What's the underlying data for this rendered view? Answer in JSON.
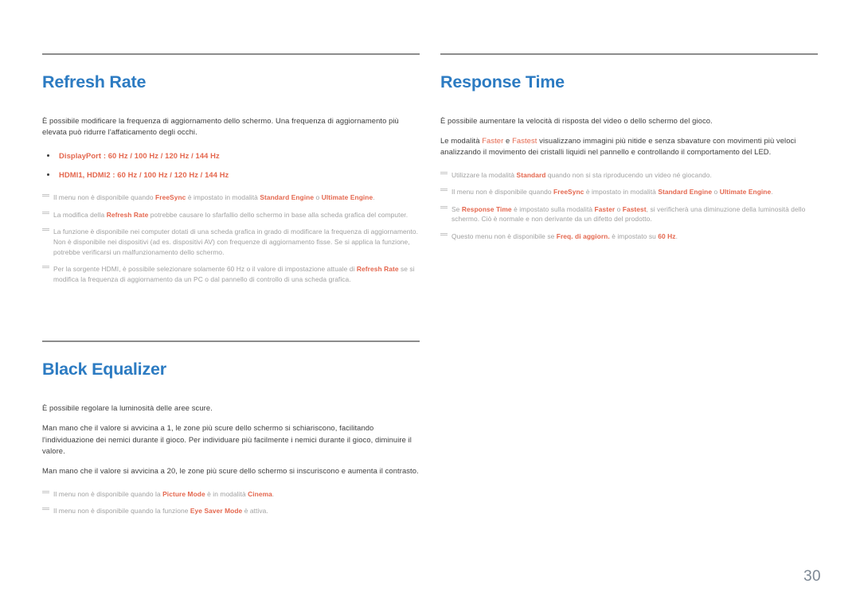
{
  "document": {
    "language": "it",
    "page_number": "30",
    "colors": {
      "heading_blue": "#2c7bc2",
      "accent_orange": "#e4674e",
      "body_gray": "#3d3d3d",
      "note_gray": "#a0a0a0",
      "rule_gray": "#8c8c8c",
      "page_number_gray": "#7d8894"
    }
  },
  "left_column": {
    "sections": [
      {
        "id": "refresh-rate",
        "title": "Refresh Rate",
        "paragraphs": [
          "È possibile modificare la frequenza di aggiornamento dello schermo. Una frequenza di aggiornamento più elevata può ridurre l'affaticamento degli occhi."
        ],
        "bullets": [
          "DisplayPort : 60 Hz / 100 Hz / 120 Hz / 144 Hz",
          "HDMI1, HDMI2 : 60 Hz / 100 Hz / 120 Hz / 144 Hz"
        ],
        "notes": [
          {
            "id": "note-freesync",
            "segments": [
              {
                "text": "Il menu non è disponibile quando ",
                "style": "plain"
              },
              {
                "text": "FreeSync",
                "style": "highlight"
              },
              {
                "text": " è impostato in modalità ",
                "style": "plain"
              },
              {
                "text": "Standard Engine",
                "style": "highlight"
              },
              {
                "text": " o ",
                "style": "plain"
              },
              {
                "text": "Ultimate Engine",
                "style": "highlight"
              },
              {
                "text": ".",
                "style": "plain"
              }
            ]
          },
          {
            "id": "note-flicker",
            "segments": [
              {
                "text": "La modifica della ",
                "style": "plain"
              },
              {
                "text": "Refresh Rate",
                "style": "highlight"
              },
              {
                "text": " potrebbe causare lo sfarfallio dello schermo in base alla scheda grafica del computer.",
                "style": "plain"
              }
            ]
          },
          {
            "id": "note-graphics-card",
            "segments": [
              {
                "text": "La funzione è disponibile nei computer dotati di una scheda grafica in grado di modificare la frequenza di aggiornamento.",
                "style": "plain"
              }
            ],
            "sub": "Non è disponibile nei dispositivi (ad es. dispositivi AV) con frequenze di aggiornamento fisse. Se si applica la funzione, potrebbe verificarsi un malfunzionamento dello schermo."
          },
          {
            "id": "note-hdmi-source",
            "segments": [
              {
                "text": "Per la sorgente HDMI, è possibile selezionare solamente 60 Hz o il valore di impostazione attuale di ",
                "style": "plain"
              },
              {
                "text": "Refresh Rate",
                "style": "highlight"
              },
              {
                "text": " se si modifica la frequenza di aggiornamento da un PC o dal pannello di controllo di una scheda grafica.",
                "style": "plain"
              }
            ]
          }
        ]
      },
      {
        "id": "black-equalizer",
        "title": "Black Equalizer",
        "paragraphs": [
          "È possibile regolare la luminosità delle aree scure.",
          "Man mano che il valore si avvicina a 1, le zone più scure dello schermo si schiariscono, facilitando l'individuazione dei nemici durante il gioco. Per individuare più facilmente i nemici durante il gioco, diminuire il valore.",
          "Man mano che il valore si avvicina a 20, le zone più scure dello schermo si inscuriscono e aumenta il contrasto."
        ],
        "bullets": [],
        "notes": [
          {
            "id": "note-picture-mode",
            "segments": [
              {
                "text": "Il menu non è disponibile quando la ",
                "style": "plain"
              },
              {
                "text": "Picture Mode",
                "style": "highlight"
              },
              {
                "text": " è in modalità ",
                "style": "plain"
              },
              {
                "text": "Cinema",
                "style": "highlight"
              },
              {
                "text": ".",
                "style": "plain"
              }
            ]
          },
          {
            "id": "note-eye-saver",
            "segments": [
              {
                "text": "Il menu non è disponibile quando la funzione ",
                "style": "plain"
              },
              {
                "text": "Eye Saver Mode",
                "style": "highlight"
              },
              {
                "text": " è attiva.",
                "style": "plain"
              }
            ]
          }
        ]
      }
    ]
  },
  "right_column": {
    "sections": [
      {
        "id": "response-time",
        "title": "Response Time",
        "rich_paragraphs": [
          [
            {
              "text": "È possibile aumentare la velocità di risposta del video o dello schermo del gioco.",
              "style": "plain"
            }
          ],
          [
            {
              "text": "Le modalità ",
              "style": "plain"
            },
            {
              "text": "Faster",
              "style": "orange"
            },
            {
              "text": " e ",
              "style": "plain"
            },
            {
              "text": "Fastest",
              "style": "orange"
            },
            {
              "text": " visualizzano immagini più nitide e senza sbavature con movimenti più veloci analizzando il movimento dei cristalli liquidi nel pannello e controllando il comportamento del LED.",
              "style": "plain"
            }
          ]
        ],
        "notes": [
          {
            "id": "note-standard-mode",
            "segments": [
              {
                "text": "Utilizzare la modalità ",
                "style": "plain"
              },
              {
                "text": "Standard",
                "style": "highlight"
              },
              {
                "text": " quando non si sta riproducendo un video né giocando.",
                "style": "plain"
              }
            ]
          },
          {
            "id": "note-freesync-rt",
            "segments": [
              {
                "text": "Il menu non è disponibile quando ",
                "style": "plain"
              },
              {
                "text": "FreeSync",
                "style": "highlight"
              },
              {
                "text": " è impostato in modalità ",
                "style": "plain"
              },
              {
                "text": "Standard Engine",
                "style": "highlight"
              },
              {
                "text": " o ",
                "style": "plain"
              },
              {
                "text": "Ultimate Engine",
                "style": "highlight"
              },
              {
                "text": ".",
                "style": "plain"
              }
            ]
          },
          {
            "id": "note-brightness",
            "segments": [
              {
                "text": "Se ",
                "style": "plain"
              },
              {
                "text": "Response Time",
                "style": "highlight"
              },
              {
                "text": " è impostato sulla modalità ",
                "style": "plain"
              },
              {
                "text": "Faster",
                "style": "highlight"
              },
              {
                "text": " o ",
                "style": "plain"
              },
              {
                "text": "Fastest",
                "style": "highlight"
              },
              {
                "text": ", si verificherà una diminuzione della luminosità dello schermo. Ciò è normale e non derivante da un difetto del prodotto.",
                "style": "plain"
              }
            ]
          },
          {
            "id": "note-freq-aggiorn",
            "segments": [
              {
                "text": "Questo menu non è disponibile se ",
                "style": "plain"
              },
              {
                "text": "Freq. di aggiorn.",
                "style": "highlight"
              },
              {
                "text": " è impostato su ",
                "style": "plain"
              },
              {
                "text": "60 Hz",
                "style": "highlight"
              },
              {
                "text": ".",
                "style": "plain"
              }
            ]
          }
        ]
      }
    ]
  }
}
